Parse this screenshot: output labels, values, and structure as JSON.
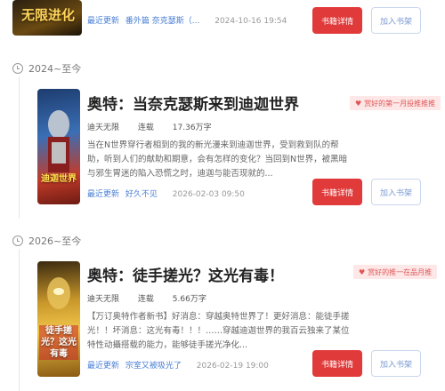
{
  "books": [
    {
      "cover_text": "无限进化",
      "latest_label": "最近更新",
      "latest_chapter": "番外篇 奈克瑟斯（...",
      "update_time": "2024-10-16 19:54",
      "detail_label": "书籍详情",
      "shelf_label": "加入书架"
    },
    {
      "period": "2024~至今",
      "title": "奥特：当奈克瑟斯来到迪迦世界",
      "badge": "赏好的第一月投推推推",
      "author": "迪天无限",
      "status": "连载",
      "words": "17.36万字",
      "desc": "当在N世界穿行者相到的我的新光漫来到迪迦世界，受到救到队的帮助，听到人们的献助和期意，会有怎样的变化？当回到N世界，被黑暗与邪生胃迷的陷入恐慌之时，迪迦与能否现就的...",
      "cover_text": "迪迦世界",
      "latest_label": "最近更新",
      "latest_chapter": "好久不见",
      "update_time": "2026-02-03 09:50",
      "detail_label": "书籍详情",
      "shelf_label": "加入书架"
    },
    {
      "period": "2026~至今",
      "title": "奥特：徒手搓光？这光有毒！",
      "badge": "赏好的推一在品月推",
      "author": "迪天无限",
      "status": "连载",
      "words": "5.66万字",
      "desc": "【万订奥特作者新书】好消息：穿越奥特世界了！更好消息：能徒手搓光！！坏消息：这光有毒！！！……穿越迪迦世界的我百云独来了某位特性动攝搭载的能力，能够徒手搓光净化...",
      "cover_text": "徒手搓光？这光有毒",
      "latest_label": "最近更新",
      "latest_chapter": "宗室又被吸光了",
      "update_time": "2026-02-19 19:00",
      "detail_label": "书籍详情",
      "shelf_label": "加入书架"
    }
  ],
  "colors": {
    "detail_bg": "#e03a3a",
    "shelf_border": "#c9d6ee",
    "link_blue": "#4a7fd6"
  }
}
